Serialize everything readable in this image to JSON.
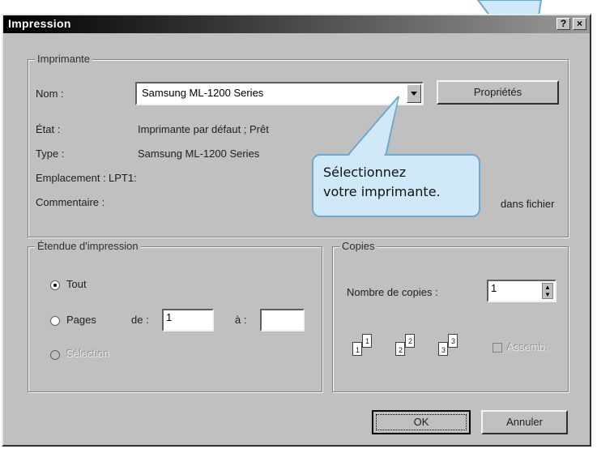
{
  "window": {
    "title": "Impression",
    "help_label": "?",
    "close_label": "×"
  },
  "printer_group": {
    "legend": "Imprimante",
    "name_label": "Nom :",
    "name_value": "Samsung ML-1200 Series",
    "properties_button": "Propriétés",
    "status_label": "État :",
    "status_value": "Imprimante par défaut ; Prêt",
    "type_label": "Type :",
    "type_value": "Samsung ML-1200 Series",
    "location_label": "Emplacement :",
    "location_value": "LPT1:",
    "comment_label": "Commentaire :",
    "print_to_file_label": "dans fichier"
  },
  "range_group": {
    "legend": "Étendue d'impression",
    "all_label": "Tout",
    "pages_label": "Pages",
    "from_label": "de :",
    "from_value": "1",
    "to_label": "à :",
    "to_value": "",
    "selection_label": "Sélection",
    "selected": "all"
  },
  "copies_group": {
    "legend": "Copies",
    "count_label": "Nombre de copies :",
    "count_value": "1",
    "collate_label": "Assemb.",
    "collate_checked": false,
    "page_icons": [
      "1",
      "1",
      "2",
      "2",
      "3",
      "3"
    ]
  },
  "buttons": {
    "ok": "OK",
    "cancel": "Annuler"
  },
  "callout": {
    "line1": "Sélectionnez",
    "line2": "votre imprimante."
  }
}
